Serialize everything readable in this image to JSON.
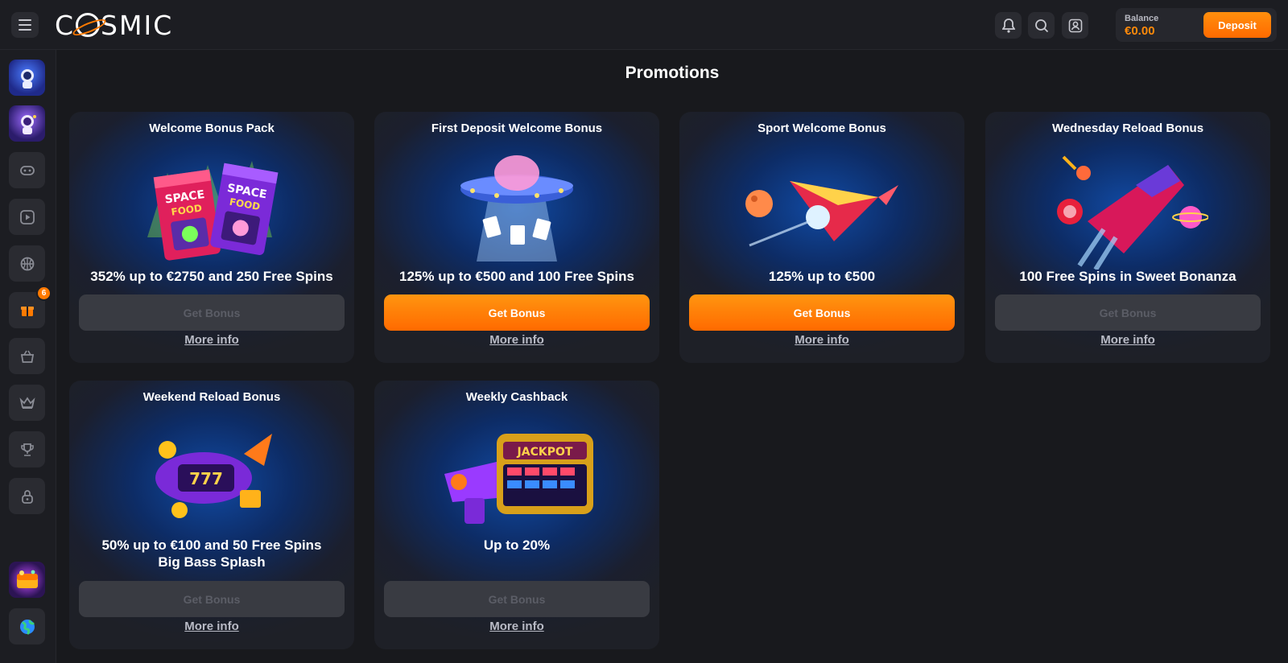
{
  "header": {
    "logo_text": "CSMIC",
    "balance_label": "Balance",
    "balance_value": "€0.00",
    "deposit_label": "Deposit",
    "icons": [
      "bell-icon",
      "search-icon",
      "profile-icon"
    ]
  },
  "sidebar": {
    "items": [
      {
        "name": "astronaut-avatar"
      },
      {
        "name": "astronaut-avatar-2"
      },
      {
        "name": "gamepad-icon"
      },
      {
        "name": "play-icon"
      },
      {
        "name": "basketball-icon"
      },
      {
        "name": "gift-icon",
        "badge": "6"
      },
      {
        "name": "basket-icon"
      },
      {
        "name": "crown-icon"
      },
      {
        "name": "trophy-icon"
      },
      {
        "name": "lock-icon"
      },
      {
        "name": "promo-chest-image"
      },
      {
        "name": "globe-icon"
      }
    ]
  },
  "page": {
    "title": "Promotions"
  },
  "promotions": [
    {
      "title": "Welcome Bonus Pack",
      "offer": "352% up to €2750 and 250 Free Spins",
      "button": "Get Bonus",
      "active": false,
      "more": "More info",
      "art": "space-food-bags"
    },
    {
      "title": "First Deposit Welcome Bonus",
      "offer": "125% up to €500 and 100 Free Spins",
      "button": "Get Bonus",
      "active": true,
      "more": "More info",
      "art": "ufo"
    },
    {
      "title": "Sport Welcome Bonus",
      "offer": "125% up to €500",
      "button": "Get Bonus",
      "active": true,
      "more": "More info",
      "art": "rocket"
    },
    {
      "title": "Wednesday Reload Bonus",
      "offer": "100 Free Spins in Sweet Bonanza",
      "button": "Get Bonus",
      "active": false,
      "more": "More info",
      "art": "spaceship"
    },
    {
      "title": "Weekend Reload Bonus",
      "offer_line1": "50% up to €100 and 50 Free Spins",
      "offer_line2": "Big Bass Splash",
      "button": "Get Bonus",
      "active": false,
      "more": "More info",
      "art": "slot-rocket"
    },
    {
      "title": "Weekly Cashback",
      "offer": "Up to 20%",
      "button": "Get Bonus",
      "active": false,
      "more": "More info",
      "art": "jackpot-machine"
    }
  ],
  "colors": {
    "accent": "#ff7a00",
    "background": "#18191d",
    "panel": "#1c1d22"
  }
}
